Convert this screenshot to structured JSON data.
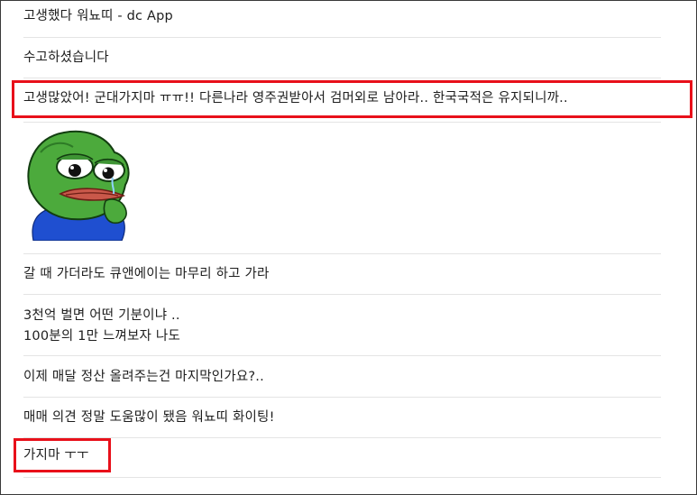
{
  "comments": [
    {
      "text": "고생했다 워뇨띠 - dc App"
    },
    {
      "text": "수고하셨습니다"
    },
    {
      "text": "고생많았어! 군대가지마 ㅠㅠ!! 다른나라 영주권받아서 검머외로 남아라.. 한국국적은 유지되니까.."
    },
    {
      "text": "갈 때 가더라도 큐앤에이는 마무리 하고 가라"
    },
    {
      "text": "3천억 벌면 어떤 기분이냐 ..",
      "text2": "100분의 1만 느껴보자 나도"
    },
    {
      "text": "이제 매달 정산 올려주는건 마지막인가요?.."
    },
    {
      "text": "매매 의견 정말 도움많이 됐음 워뇨띠 화이팅!"
    },
    {
      "text": "가지마 ㅜㅜ"
    }
  ],
  "sticker_icon": "crying-pepe-frog-sticker",
  "highlight_color": "#e8101a"
}
